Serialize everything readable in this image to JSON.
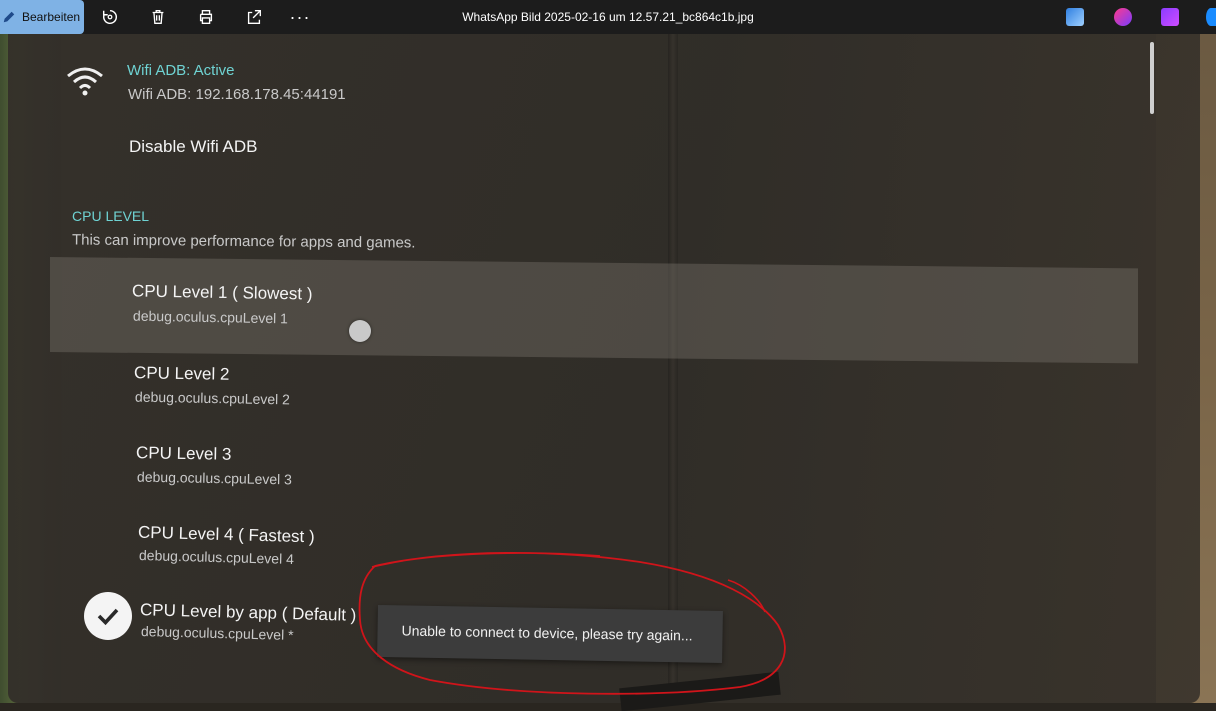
{
  "window": {
    "title": "WhatsApp Bild 2025-02-16 um 12.57.21_bc864c1b.jpg"
  },
  "toolbar": {
    "edit_label": "Bearbeiten",
    "icons": [
      "edit-icon",
      "rotate-icon",
      "delete-icon",
      "print-icon",
      "share-icon",
      "more-icon"
    ],
    "more_label": "···"
  },
  "settings": {
    "wifi": {
      "status": "Wifi ADB: Active",
      "address": "Wifi ADB: 192.168.178.45:44191",
      "disable_label": "Disable Wifi ADB"
    },
    "cpu": {
      "heading": "CPU LEVEL",
      "description": "This can improve performance for apps and games.",
      "options": [
        {
          "label": "CPU Level 1 ( Slowest )",
          "prop": "debug.oculus.cpuLevel 1"
        },
        {
          "label": "CPU Level 2",
          "prop": "debug.oculus.cpuLevel 2"
        },
        {
          "label": "CPU Level 3",
          "prop": "debug.oculus.cpuLevel 3"
        },
        {
          "label": "CPU Level 4 ( Fastest )",
          "prop": "debug.oculus.cpuLevel 4"
        },
        {
          "label": "CPU Level by app ( Default )",
          "prop": "debug.oculus.cpuLevel *"
        }
      ],
      "selected_index": 4
    }
  },
  "toast": {
    "message": "Unable to connect to device, please try again..."
  },
  "colors": {
    "accent_teal": "#6fd3d3",
    "annotation_red": "#d0141a",
    "edit_button": "#7fb2e5"
  }
}
